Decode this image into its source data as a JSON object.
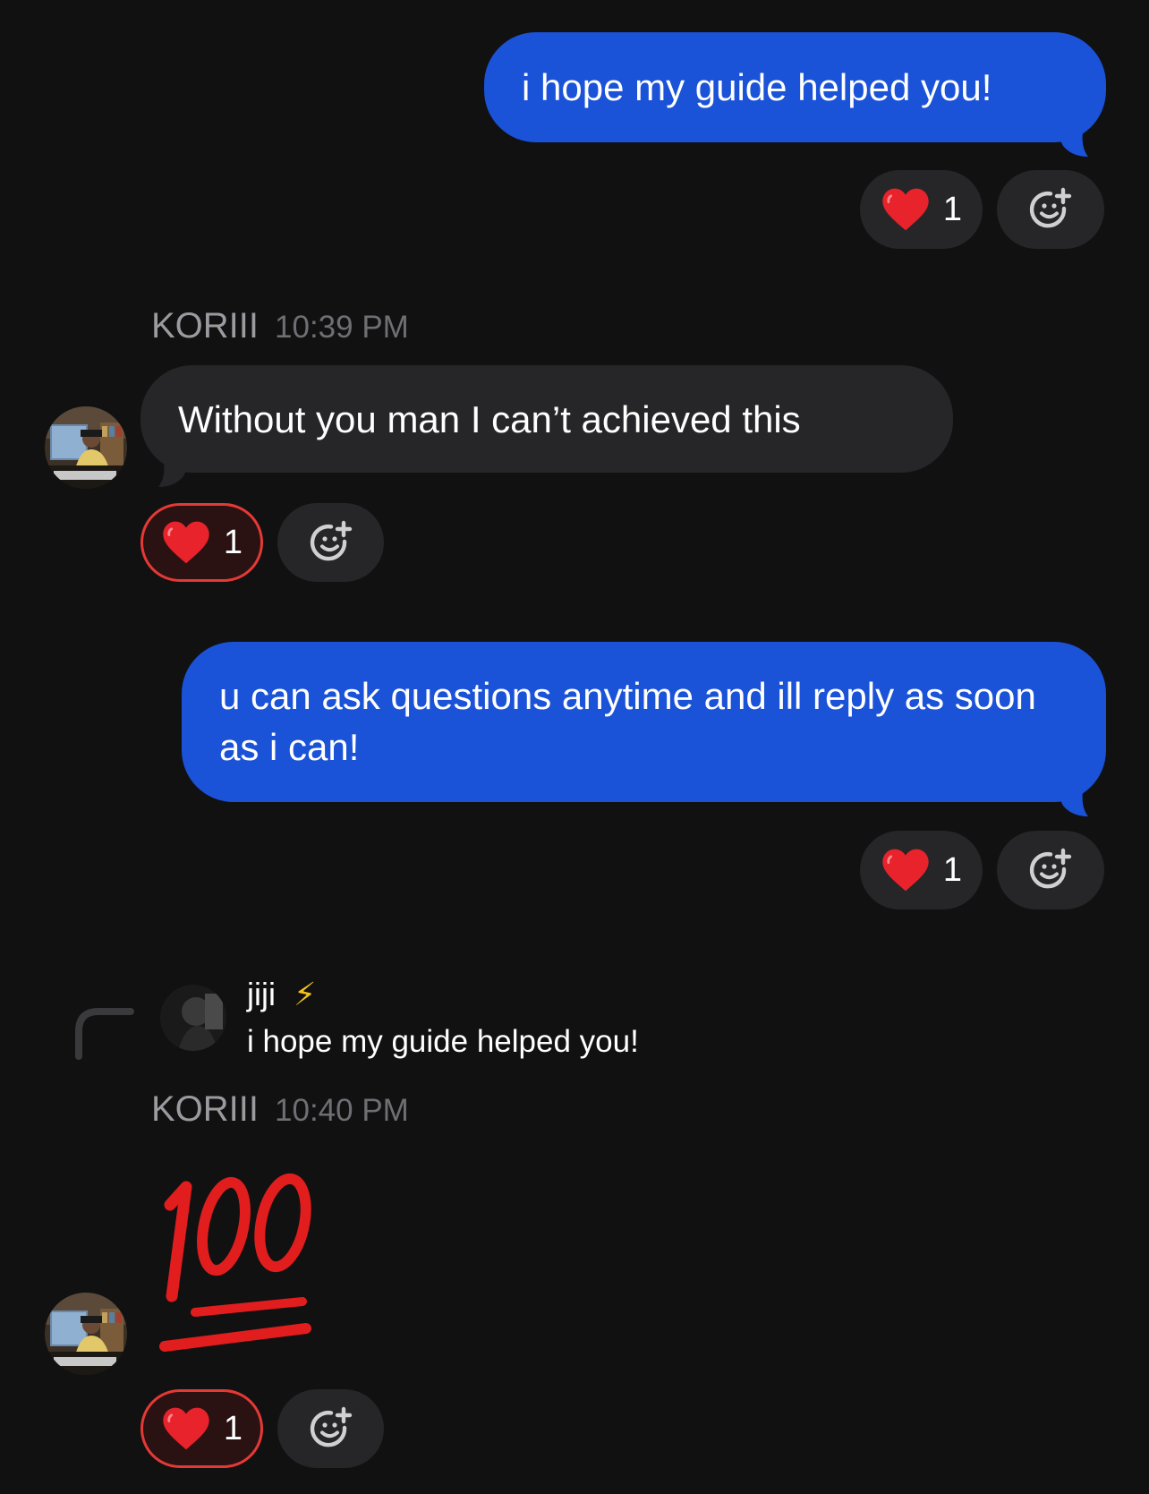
{
  "messages": {
    "m1": {
      "text": "i hope my guide helped you!",
      "reaction": {
        "emoji": "heart",
        "count": "1"
      }
    },
    "m2": {
      "sender": "KORIII",
      "time": "10:39 PM",
      "text": "Without you man I can’t achieved this",
      "reaction": {
        "emoji": "heart",
        "count": "1"
      }
    },
    "m3": {
      "text": "u can ask questions anytime and ill reply as soon as i can!",
      "reaction": {
        "emoji": "heart",
        "count": "1"
      }
    },
    "m4": {
      "reply_to": {
        "name": "jiji",
        "badge": "⚡",
        "text": "i hope my guide helped you!"
      },
      "sender": "KORIII",
      "time": "10:40 PM",
      "emoji": "hundred-points",
      "reaction": {
        "emoji": "heart",
        "count": "1"
      }
    }
  },
  "colors": {
    "background": "#111112",
    "outgoing": "#1a52d8",
    "incoming": "#262628",
    "reaction_active_border": "#e53935"
  }
}
